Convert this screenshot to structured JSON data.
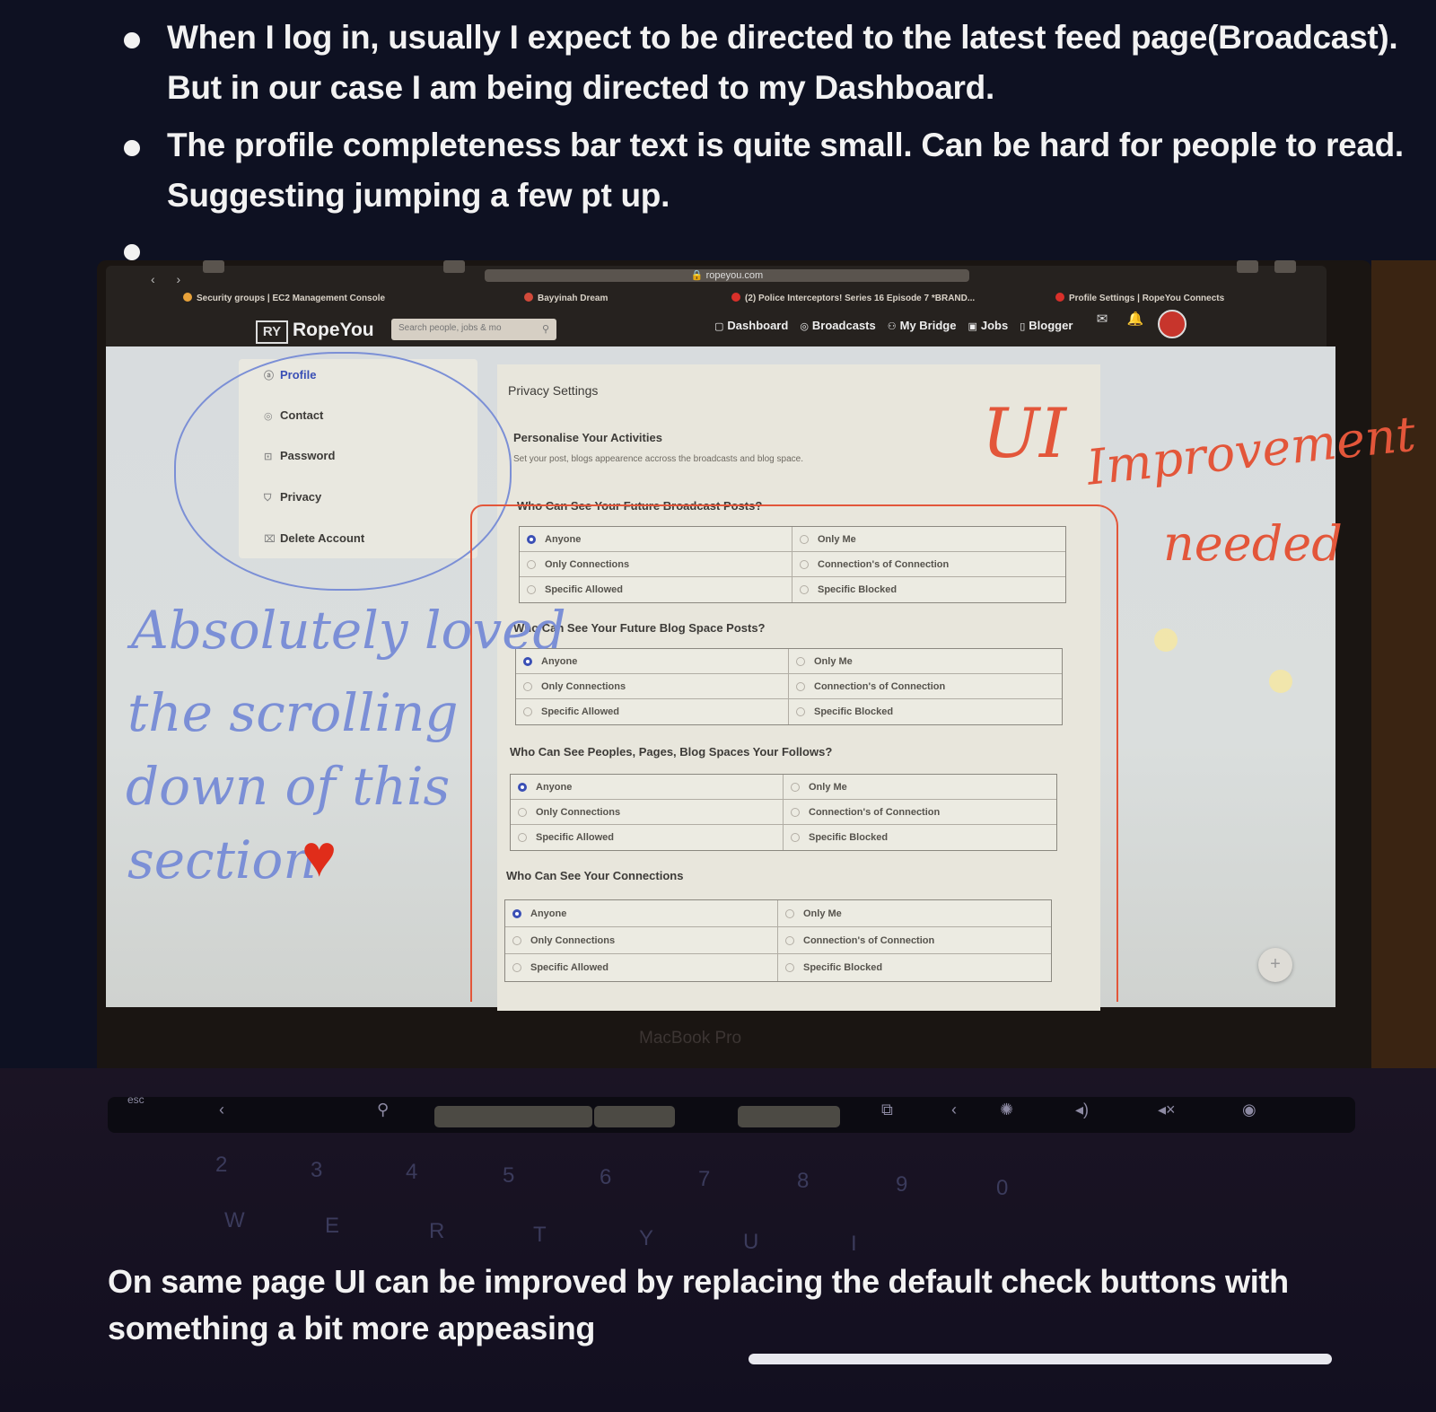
{
  "notes": [
    "When I log in,  usually I expect to be directed to the latest feed page(Broadcast). But in our case I am being directed to my Dashboard.",
    "The profile completeness bar text is quite small. Can be hard for people to read. Suggesting jumping a few pt up.",
    ""
  ],
  "browser": {
    "url": "ropeyou.com",
    "tabs": [
      "Security groups | EC2 Management Console",
      "Bayyinah Dream",
      "(2) Police Interceptors! Series 16 Episode 7 *BRAND...",
      "Profile Settings | RopeYou Connects"
    ]
  },
  "site": {
    "logo_mark": "RY",
    "logo_text": "RopeYou",
    "search_placeholder": "Search people, jobs & mo",
    "nav": [
      "Dashboard",
      "Broadcasts",
      "My Bridge",
      "Jobs",
      "Blogger"
    ]
  },
  "sidebar": {
    "items": [
      {
        "label": "Profile",
        "icon": "user-icon"
      },
      {
        "label": "Contact",
        "icon": "contact-icon"
      },
      {
        "label": "Password",
        "icon": "lock-icon"
      },
      {
        "label": "Privacy",
        "icon": "shield-icon"
      },
      {
        "label": "Delete Account",
        "icon": "trash-icon"
      }
    ]
  },
  "privacy": {
    "title": "Privacy Settings",
    "section_title": "Personalise Your Activities",
    "section_subtitle": "Set your post, blogs appearence accross the broadcasts and blog space.",
    "questions": [
      {
        "label": "Who Can See Your Future Broadcast Posts?",
        "options": [
          "Anyone",
          "Only Me",
          "Only Connections",
          "Connection's of Connection",
          "Specific Allowed",
          "Specific Blocked"
        ],
        "selected": "Anyone"
      },
      {
        "label": "Who Can See Your Future Blog Space Posts?",
        "options": [
          "Anyone",
          "Only Me",
          "Only Connections",
          "Connection's of Connection",
          "Specific Allowed",
          "Specific Blocked"
        ],
        "selected": "Anyone"
      },
      {
        "label": "Who Can See Peoples, Pages, Blog Spaces Your Follows?",
        "options": [
          "Anyone",
          "Only Me",
          "Only Connections",
          "Connection's of Connection",
          "Specific Allowed",
          "Specific Blocked"
        ],
        "selected": "Anyone"
      },
      {
        "label": "Who Can See Your Connections",
        "options": [
          "Anyone",
          "Only Me",
          "Only Connections",
          "Connection's of Connection",
          "Specific Allowed",
          "Specific Blocked"
        ],
        "selected": "Anyone"
      }
    ]
  },
  "annotations": {
    "blue_lines": [
      "Absolutely loved",
      "the scrolling",
      "down of this",
      "section"
    ],
    "red_title": "UI",
    "red_lines": [
      "Improvement",
      "needed"
    ]
  },
  "device": {
    "brand": "MacBook Pro"
  },
  "keyboard": {
    "esc": "esc",
    "keys": [
      "2",
      "3",
      "4",
      "5",
      "6",
      "7",
      "8",
      "9",
      "0",
      "W",
      "E",
      "R",
      "T",
      "Y",
      "U",
      "I"
    ]
  },
  "bottom_note": "On same page UI can be improved by replacing the default check buttons with something a bit more appeasing",
  "colors": {
    "accent": "#3a4fb5",
    "annotation_blue": "#7b8fd6",
    "annotation_red": "#e3563a",
    "heart": "#e02d1a"
  }
}
